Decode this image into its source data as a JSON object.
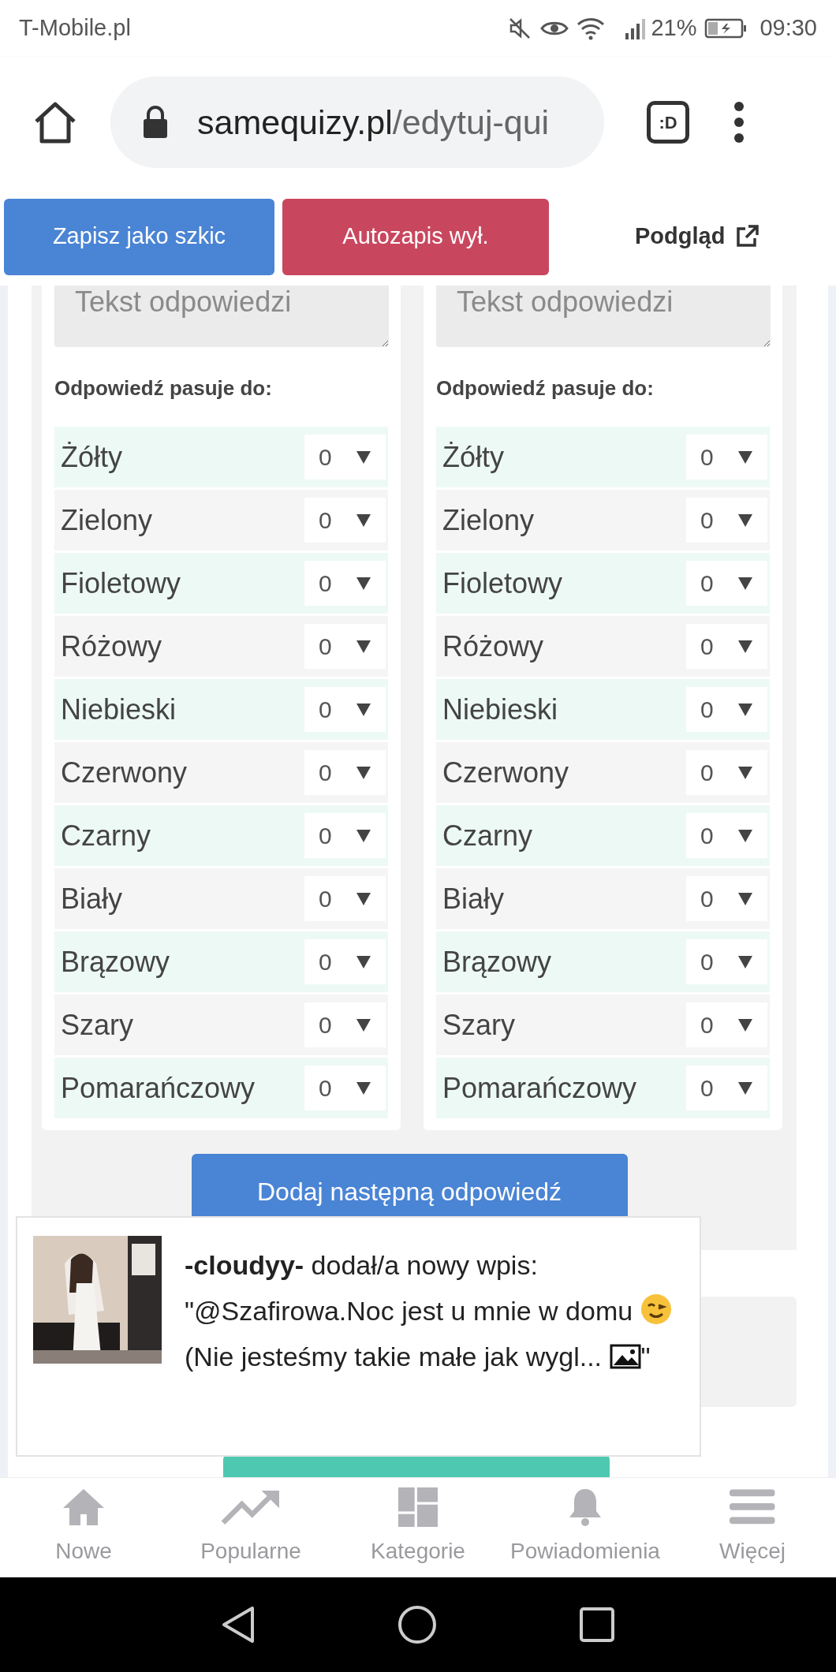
{
  "status_bar": {
    "carrier": "T-Mobile.pl",
    "battery": "21%",
    "time": "09:30"
  },
  "browser": {
    "url_domain": "samequizy.pl",
    "url_path": "/edytuj-qui",
    "tab_button": ":D"
  },
  "toolbar": {
    "save_button": "Zapisz jako szkic",
    "autosave_button": "Autozapis wył.",
    "preview_link": "Podgląd"
  },
  "answers": [
    {
      "placeholder": "Tekst odpowiedzi",
      "label": "Odpowiedź pasuje do:",
      "matches": [
        {
          "name": "Żółty",
          "value": "0"
        },
        {
          "name": "Zielony",
          "value": "0"
        },
        {
          "name": "Fioletowy",
          "value": "0"
        },
        {
          "name": "Różowy",
          "value": "0"
        },
        {
          "name": "Niebieski",
          "value": "0"
        },
        {
          "name": "Czerwony",
          "value": "0"
        },
        {
          "name": "Czarny",
          "value": "0"
        },
        {
          "name": "Biały",
          "value": "0"
        },
        {
          "name": "Brązowy",
          "value": "0"
        },
        {
          "name": "Szary",
          "value": "0"
        },
        {
          "name": "Pomarańczowy",
          "value": "0"
        }
      ]
    },
    {
      "placeholder": "Tekst odpowiedzi",
      "label": "Odpowiedź pasuje do:",
      "matches": [
        {
          "name": "Żółty",
          "value": "0"
        },
        {
          "name": "Zielony",
          "value": "0"
        },
        {
          "name": "Fioletowy",
          "value": "0"
        },
        {
          "name": "Różowy",
          "value": "0"
        },
        {
          "name": "Niebieski",
          "value": "0"
        },
        {
          "name": "Czerwony",
          "value": "0"
        },
        {
          "name": "Czarny",
          "value": "0"
        },
        {
          "name": "Biały",
          "value": "0"
        },
        {
          "name": "Brązowy",
          "value": "0"
        },
        {
          "name": "Szary",
          "value": "0"
        },
        {
          "name": "Pomarańczowy",
          "value": "0"
        }
      ]
    }
  ],
  "add_answer_button": "Dodaj następną odpowiedź",
  "notification": {
    "kind": "picture",
    "text_parts": [
      "**-cloudyy-** dodał/a nowy wpis: \"@Szafirowa.Noc jest u mnie w domu",
      "(Nie jesteśmy takie małe jak wygl...",
      "\""
    ]
  },
  "bottom_nav": [
    {
      "label": "Nowe"
    },
    {
      "label": "Popularne"
    },
    {
      "label": "Kategorie"
    },
    {
      "label": "Powiadomienia"
    },
    {
      "label": "Więcej"
    }
  ]
}
